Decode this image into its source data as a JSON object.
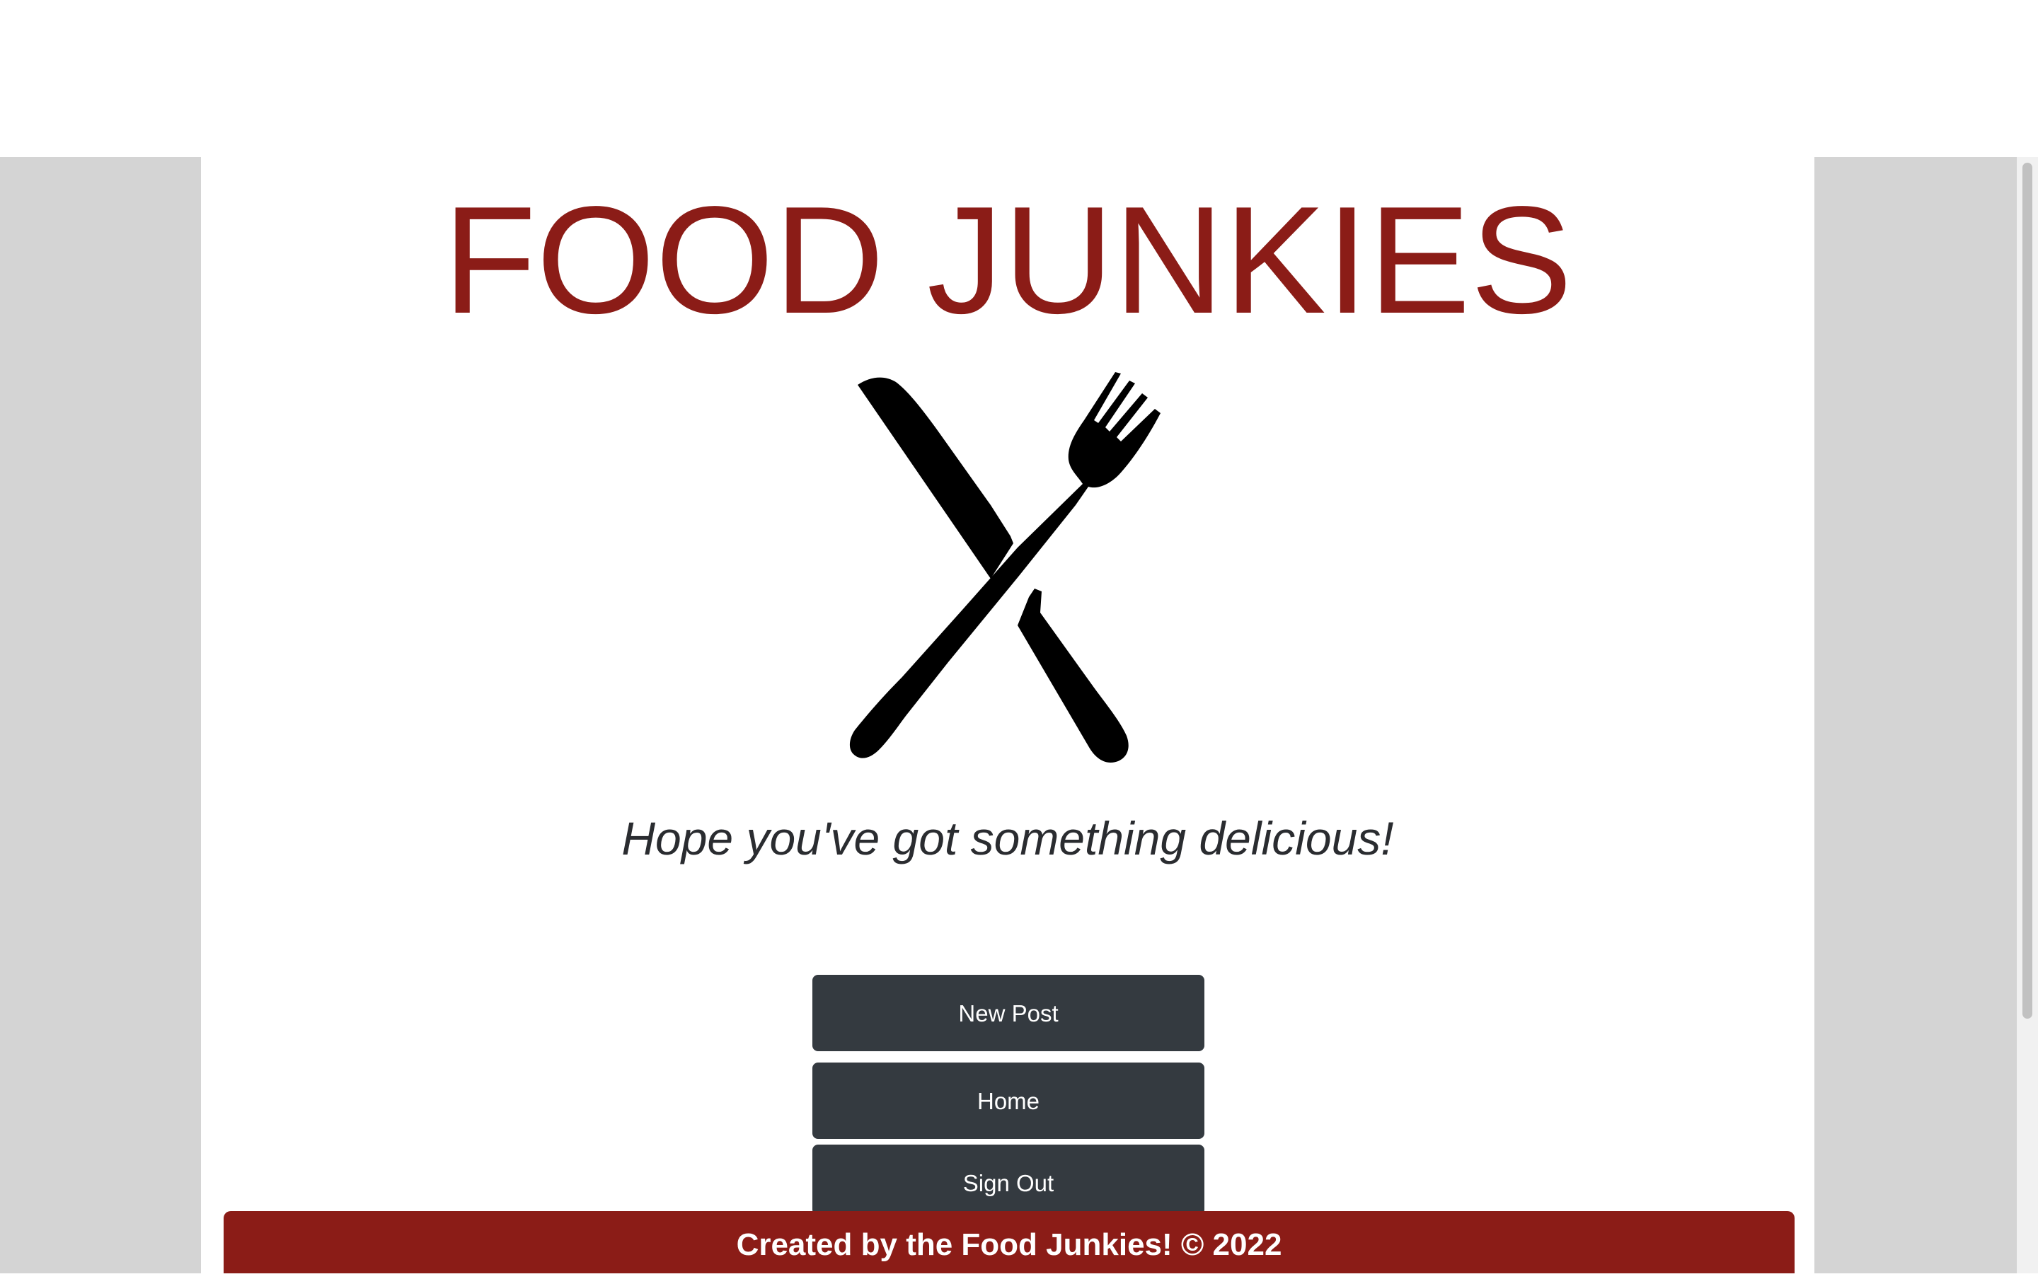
{
  "header": {
    "title": "FOOD JUNKIES",
    "title_color": "#8b1c17",
    "logo_icon": "crossed-knife-fork-icon"
  },
  "tagline": "Hope you've got something delicious!",
  "actions": {
    "new_post_label": "New Post",
    "home_label": "Home",
    "sign_out_label": "Sign Out",
    "button_color": "#343a40"
  },
  "footer": {
    "text": "Created by the Food Junkies! © 2022",
    "background": "#8b1c17"
  }
}
